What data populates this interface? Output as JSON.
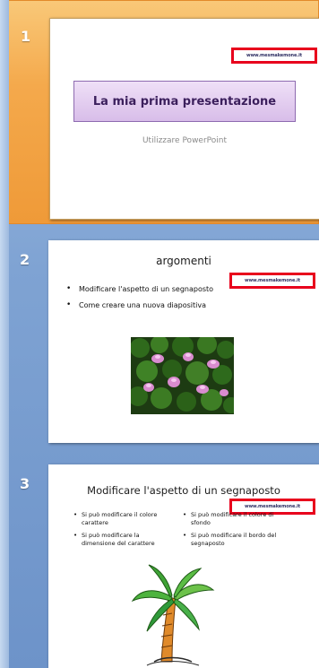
{
  "slides_pane": {
    "slides": [
      {
        "number": "1",
        "selected": true,
        "url_overlay": "www.mesmakemone.it",
        "title": "La mia prima presentazione",
        "subtitle": "Utilizzare PowerPoint"
      },
      {
        "number": "2",
        "selected": false,
        "url_overlay": "www.mesmakemone.it",
        "title": "argomenti",
        "bullets": [
          "Modificare l'aspetto di un segnaposto",
          "Come creare una nuova diapositiva"
        ]
      },
      {
        "number": "3",
        "selected": false,
        "url_overlay": "www.mesmakemone.it",
        "title": "Modificare l'aspetto di un segnaposto",
        "left_bullets": [
          "Si può modificare il colore carattere",
          "Si può modificare la dimensione del carattere"
        ],
        "right_bullets": [
          "Si può modificare il colore di sfondo",
          "Si può modificare il bordo del segnaposto"
        ]
      }
    ]
  },
  "colors": {
    "selected_row": "#f4a94c",
    "pane_background": "#7fa3d3",
    "highlight_border": "#e8001c",
    "title_box_fill": "#d8bde9",
    "title_text": "#3b1f5c"
  }
}
